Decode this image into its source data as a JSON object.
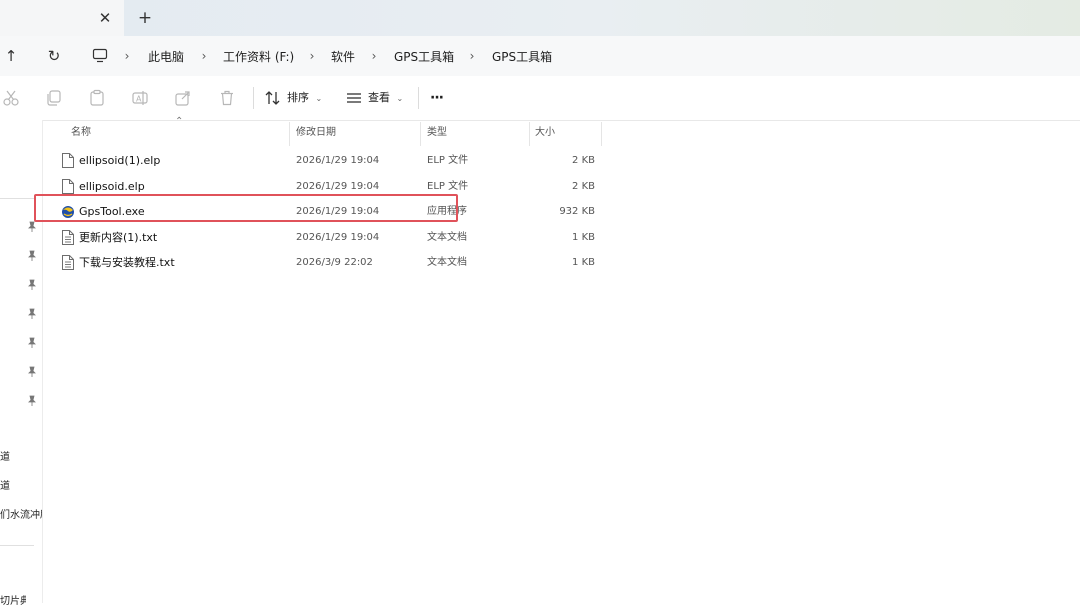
{
  "tabbar": {
    "close_glyph": "✕",
    "new_tab_glyph": "+"
  },
  "address": {
    "up_glyph": "↑",
    "refresh_glyph": "↻",
    "breadcrumbs": [
      "此电脑",
      "工作资料 (F:)",
      "软件",
      "GPS工具箱",
      "GPS工具箱"
    ],
    "separator": "›"
  },
  "commandbar": {
    "sort_label": "排序",
    "view_label": "查看",
    "more_label": "···",
    "icons": [
      "cut-icon",
      "copy-icon",
      "paste-icon",
      "rename-icon",
      "share-icon",
      "delete-icon",
      "sort-icon",
      "view-icon"
    ]
  },
  "sidebar": {
    "pin_glyph": "📌",
    "items": [
      "道",
      "道",
      "们水流冲刷",
      "切片典"
    ]
  },
  "columns": {
    "name": "名称",
    "modified": "修改日期",
    "type": "类型",
    "size": "大小"
  },
  "files": [
    {
      "name": "ellipsoid(1).elp",
      "modified": "2026/1/29 19:04",
      "type": "ELP 文件",
      "size": "2 KB",
      "icon": "file-icon"
    },
    {
      "name": "ellipsoid.elp",
      "modified": "2026/1/29 19:04",
      "type": "ELP 文件",
      "size": "2 KB",
      "icon": "file-icon"
    },
    {
      "name": "GpsTool.exe",
      "modified": "2026/1/29 19:04",
      "type": "应用程序",
      "size": "932 KB",
      "icon": "app-icon"
    },
    {
      "name": "更新内容(1).txt",
      "modified": "2026/1/29 19:04",
      "type": "文本文档",
      "size": "1 KB",
      "icon": "text-file-icon"
    },
    {
      "name": "下载与安装教程.txt",
      "modified": "2026/3/9 22:02",
      "type": "文本文档",
      "size": "1 KB",
      "icon": "text-file-icon"
    }
  ],
  "colors": {
    "highlight_border": "#e0525a",
    "accent": "#2f6fb5"
  }
}
